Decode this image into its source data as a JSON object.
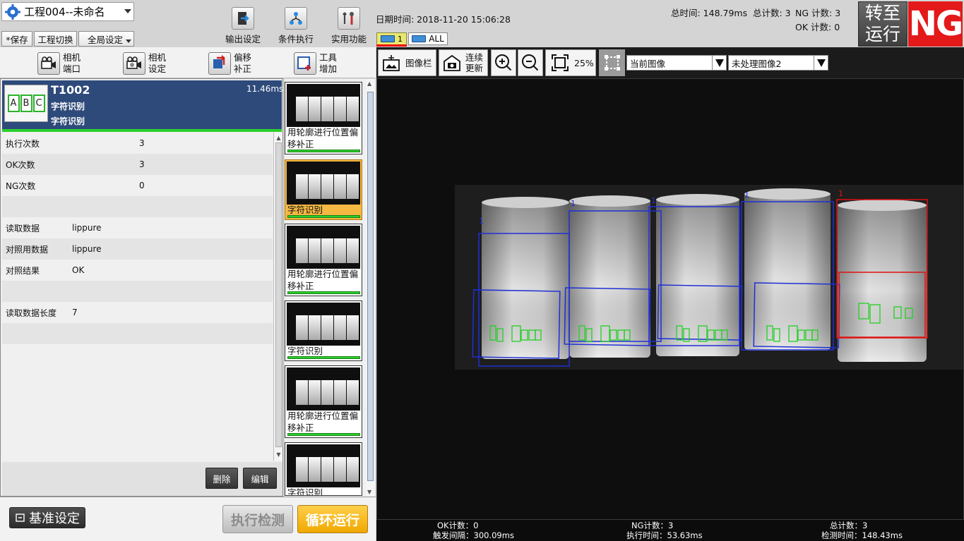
{
  "project": {
    "name": "工程004--未命名"
  },
  "top_buttons": {
    "save": "*保存",
    "switch": "工程切换",
    "global": "全局设定"
  },
  "top_tools": [
    {
      "label": "输出设定",
      "icon": "output-settings-icon"
    },
    {
      "label": "条件执行",
      "icon": "conditional-exec-icon"
    },
    {
      "label": "实用功能",
      "icon": "utility-tools-icon"
    }
  ],
  "datetime": "日期时间: 2018-11-20 15:06:28",
  "camera_tabs": {
    "cam1": "1",
    "all": "ALL"
  },
  "stats": {
    "total_time": "总时间: 148.79ms",
    "total_count": "总计数: 3",
    "ng_count": "NG 计数: 3",
    "ok_count": "OK 计数: 0"
  },
  "run_button": {
    "line1": "转至",
    "line2": "运行"
  },
  "status": {
    "result": "NG",
    "color": "#e3191a"
  },
  "left_toolbar": [
    {
      "line1": "相机",
      "line2": "端口",
      "icon": "camera-port-icon"
    },
    {
      "line1": "相机",
      "line2": "设定",
      "icon": "camera-settings-icon"
    },
    {
      "line1": "偏移",
      "line2": "补正",
      "icon": "offset-correction-icon"
    },
    {
      "line1": "工具",
      "line2": "增加",
      "icon": "add-tool-icon"
    }
  ],
  "tool_header": {
    "id": "T1002",
    "name1": "字符识别",
    "name2": "字符识别",
    "time": "11.46ms",
    "abc": [
      "A",
      "B",
      "C"
    ]
  },
  "properties": [
    {
      "key": "执行次数",
      "value": "3"
    },
    {
      "key": "OK次数",
      "value": "3"
    },
    {
      "key": "NG次数",
      "value": "0"
    },
    {
      "key": "",
      "value": ""
    },
    {
      "key": "读取数据",
      "value": "lippure"
    },
    {
      "key": "对照用数据",
      "value": "lippure"
    },
    {
      "key": "对照结果",
      "value": "OK"
    },
    {
      "key": "",
      "value": ""
    },
    {
      "key": "读取数据长度",
      "value": "7"
    },
    {
      "key": "",
      "value": ""
    }
  ],
  "panel_buttons": {
    "delete": "删除",
    "edit": "编辑"
  },
  "thumbnails": [
    {
      "label": "用轮廓进行位置偏移补正",
      "selected": false
    },
    {
      "label": "字符识别",
      "selected": true
    },
    {
      "label": "用轮廓进行位置偏移补正",
      "selected": false
    },
    {
      "label": "字符识别",
      "selected": false
    },
    {
      "label": "用轮廓进行位置偏移补正",
      "selected": false
    },
    {
      "label": "字符识别",
      "selected": false
    }
  ],
  "bottom_left": {
    "base": "基准设定",
    "exec": "执行检测",
    "loop": "循环运行"
  },
  "viewer_toolbar": {
    "image_bar": "图像栏",
    "continuous1": "连续",
    "continuous2": "更新",
    "zoom": "25%",
    "image_select": "当前图像",
    "process_select": "未处理图像2"
  },
  "viewer_footer": {
    "ok_count": "OK计数：0",
    "trigger_interval": "触发间隔：300.09ms",
    "ng_count": "NG计数：3",
    "exec_time": "执行时间：53.63ms",
    "total_count": "总计数：3",
    "detect_time": "检测时间：148.43ms"
  },
  "overlay": {
    "ok_color": "#1f2fd6",
    "ng_color": "#e01010",
    "ocr_color": "#22d022",
    "ng_label": "1",
    "ok_label": "1"
  }
}
